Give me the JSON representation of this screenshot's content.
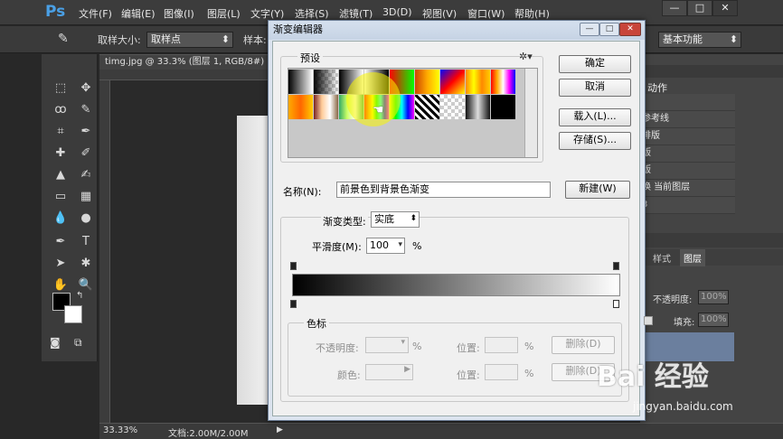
{
  "app": {
    "logo": "Ps",
    "menus": [
      "文件(F)",
      "编辑(E)",
      "图像(I)",
      "图层(L)",
      "文字(Y)",
      "选择(S)",
      "滤镜(T)",
      "3D(D)",
      "视图(V)",
      "窗口(W)",
      "帮助(H)"
    ],
    "window_controls": [
      "—",
      "□",
      "✕"
    ]
  },
  "options_bar": {
    "sample_size_label": "取样大小:",
    "sample_size_value": "取样点",
    "sample_label": "样本:",
    "workspace": "基本功能"
  },
  "document": {
    "tab": "timg.jpg @ 33.3% (图层 1, RGB/8#)",
    "zoom": "33.33%",
    "doc_size": "文档:2.00M/2.00M"
  },
  "right_panel": {
    "actions_title": "动作",
    "items": [
      "",
      "参考线",
      "排版",
      "版",
      "版",
      "换 当前图层",
      "3"
    ],
    "tabs": [
      "样式",
      "图层"
    ],
    "opacity_label": "不透明度:",
    "opacity_value": "100%",
    "fill_label": "填充:",
    "fill_value": "100%"
  },
  "dialog": {
    "title": "渐变编辑器",
    "presets_label": "预设",
    "ok": "确定",
    "cancel": "取消",
    "load": "载入(L)...",
    "save": "存储(S)...",
    "name_label": "名称(N):",
    "name_value": "前景色到背景色渐变",
    "new_button": "新建(W)",
    "gradient_type_label": "渐变类型:",
    "gradient_type_value": "实底",
    "smoothness_label": "平滑度(M):",
    "smoothness_value": "100",
    "percent": "%",
    "stops_group": "色标",
    "opacity_label": "不透明度:",
    "location_label": "位置:",
    "delete_label": "删除(D)",
    "color_label": "颜色:",
    "percent2": "%"
  },
  "watermark": {
    "brand": "Bai 经验",
    "url": "jingyan.baidu.com"
  },
  "colors": {
    "ps_blue": "#4aa0e6",
    "dialog_bg": "#f0f0f0",
    "panel_dark": "#3b3b3b"
  }
}
